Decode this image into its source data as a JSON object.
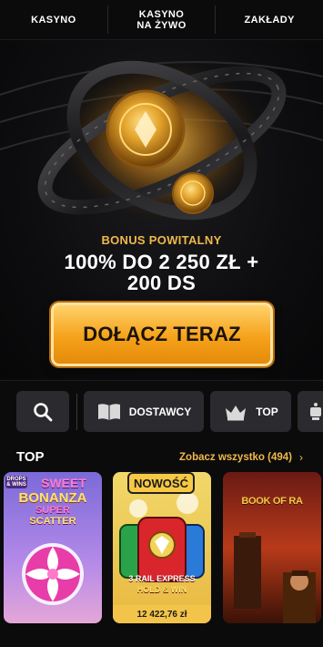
{
  "nav": {
    "items": [
      {
        "label": "KASYNO"
      },
      {
        "label_line1": "KASYNO",
        "label_line2": "NA ŻYWO"
      },
      {
        "label": "ZAKŁADY"
      }
    ]
  },
  "hero": {
    "bonus_label": "BONUS POWITALNY",
    "bonus_line1": "100% DO 2 250 ZŁ +",
    "bonus_line2": "200 DS",
    "cta_label": "DOŁĄCZ TERAZ"
  },
  "filters": {
    "search_icon": "search-icon",
    "providers_label": "DOSTAWCY",
    "top_label": "TOP"
  },
  "top_section": {
    "title": "TOP",
    "see_all": "Zobacz wszystko (494)",
    "see_all_arrow": "›"
  },
  "games": [
    {
      "name_line1": "SWEET",
      "name_line2": "BONANZA",
      "name_line3": "SUPER",
      "name_line4": "SCATTER",
      "tag": "DROPS & WINS"
    },
    {
      "badge": "NOWOŚĆ",
      "name_line1": "3 RAIL EXPRESS",
      "name_line2": "HOLD & WIN",
      "jackpot": "12 422,76 zł"
    },
    {
      "name": "BOOK OF RA"
    }
  ],
  "colors": {
    "accent": "#f0b94a",
    "button": "#f5a21a",
    "chip": "#2b2b2f"
  }
}
